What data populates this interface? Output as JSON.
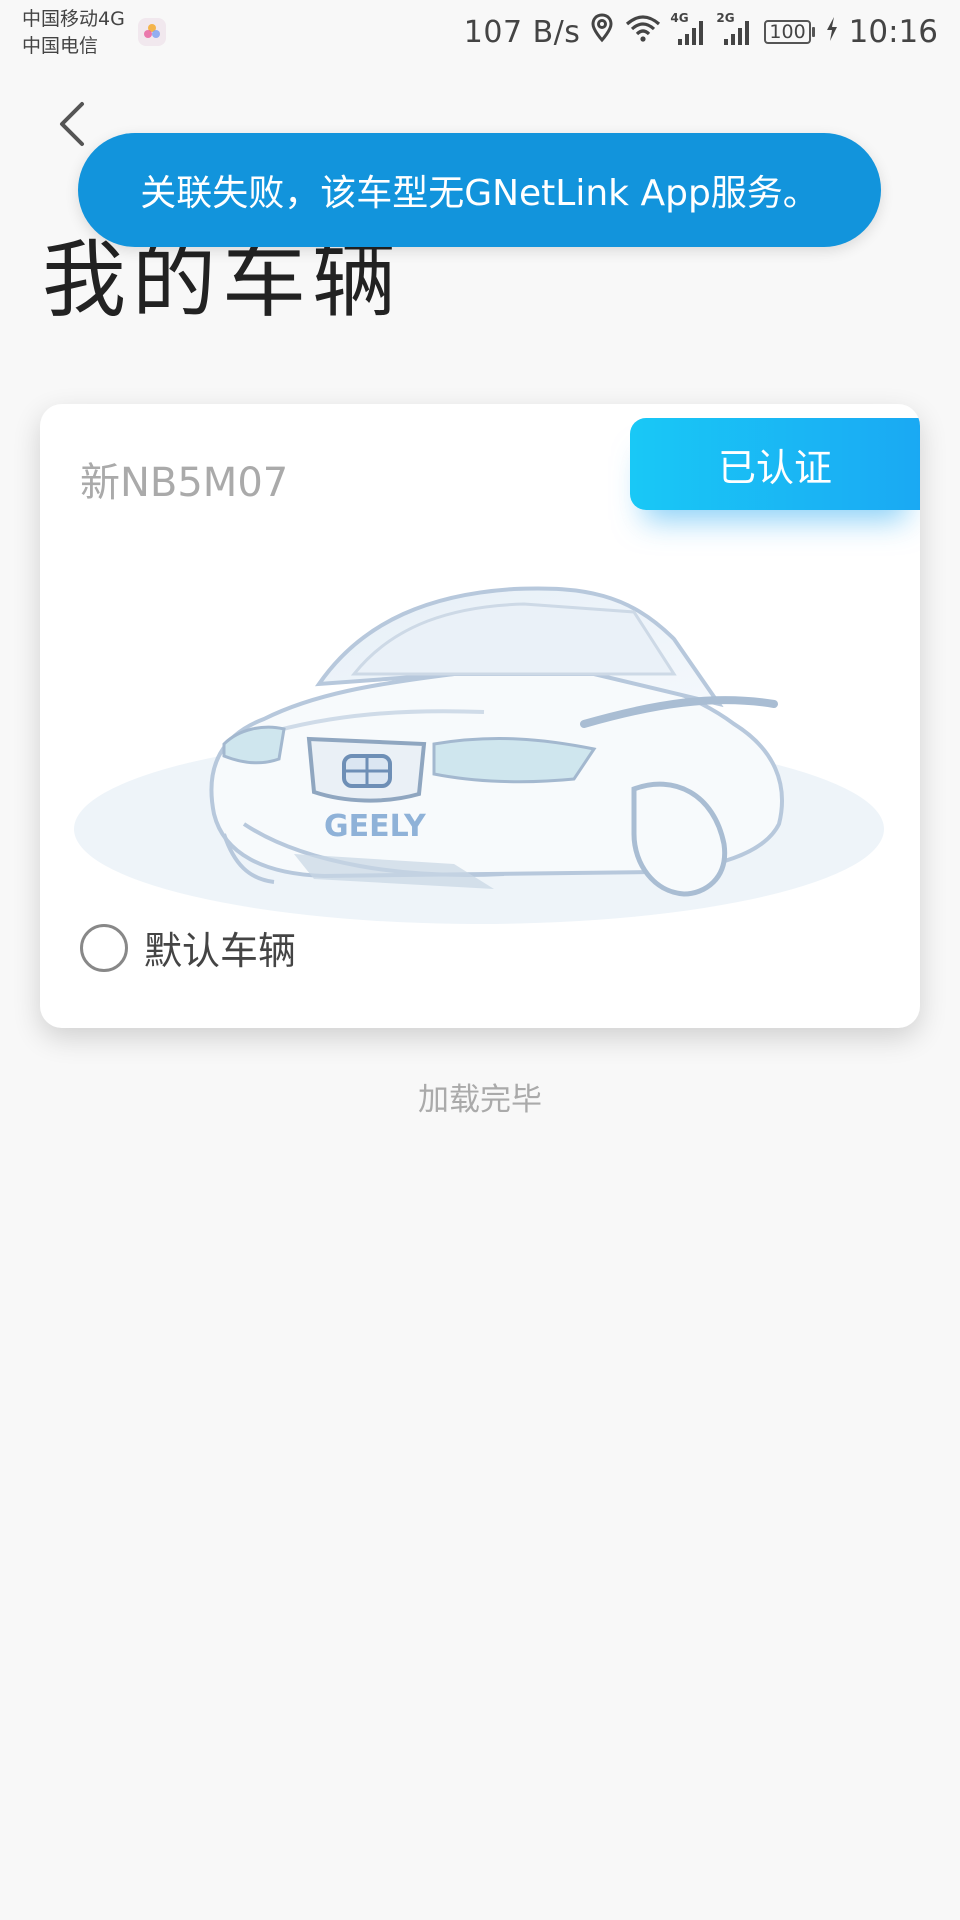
{
  "status_bar": {
    "carrier_1": "中国移动4G",
    "carrier_2": "中国电信",
    "net_speed": "107 B/s",
    "sim1_tag": "4G",
    "sim2_tag": "2G",
    "battery": "100",
    "time": "10:16"
  },
  "page": {
    "title": "我的车辆"
  },
  "toast": {
    "message": "关联失败，该车型无GNetLink App服务。"
  },
  "vehicle": {
    "plate": "新NB5M07",
    "badge": "已认证",
    "brand": "GEELY",
    "default_label": "默认车辆",
    "is_default": false
  },
  "list": {
    "load_status": "加载完毕"
  },
  "colors": {
    "toast_bg": "#1294dc",
    "badge_bg": "#1aa9f3",
    "page_bg": "#f8f8f8"
  }
}
